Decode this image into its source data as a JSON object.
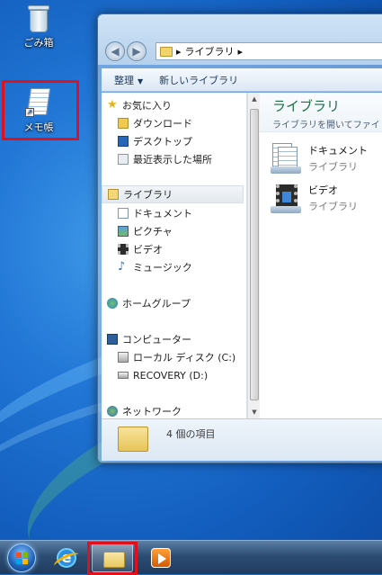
{
  "desktop": {
    "icons": [
      {
        "label": "ごみ箱",
        "icon": "recycle-bin-icon"
      },
      {
        "label": "メモ帳",
        "icon": "notepad-icon"
      }
    ],
    "highlight_color": "#e0111c"
  },
  "explorer": {
    "address": {
      "crumb": "ライブラリ",
      "separator": "▸"
    },
    "toolbar": {
      "organize": "整理",
      "new_library": "新しいライブラリ"
    },
    "nav": {
      "favorites": {
        "label": "お気に入り",
        "items": [
          "ダウンロード",
          "デスクトップ",
          "最近表示した場所"
        ]
      },
      "libraries": {
        "label": "ライブラリ",
        "items": [
          "ドキュメント",
          "ピクチャ",
          "ビデオ",
          "ミュージック"
        ]
      },
      "homegroup": "ホームグループ",
      "computer": {
        "label": "コンピューター",
        "items": [
          "ローカル ディスク (C:)",
          "RECOVERY (D:)"
        ]
      },
      "network": "ネットワーク"
    },
    "content": {
      "title": "ライブラリ",
      "subtitle": "ライブラリを開いてファイ",
      "items": [
        {
          "name": "ドキュメント",
          "kind": "ライブラリ"
        },
        {
          "name": "ビデオ",
          "kind": "ライブラリ"
        }
      ]
    },
    "status": {
      "count": "4 個の項目"
    }
  },
  "taskbar": {
    "buttons": [
      "start-orb",
      "internet-explorer",
      "windows-explorer",
      "windows-media-player"
    ]
  }
}
